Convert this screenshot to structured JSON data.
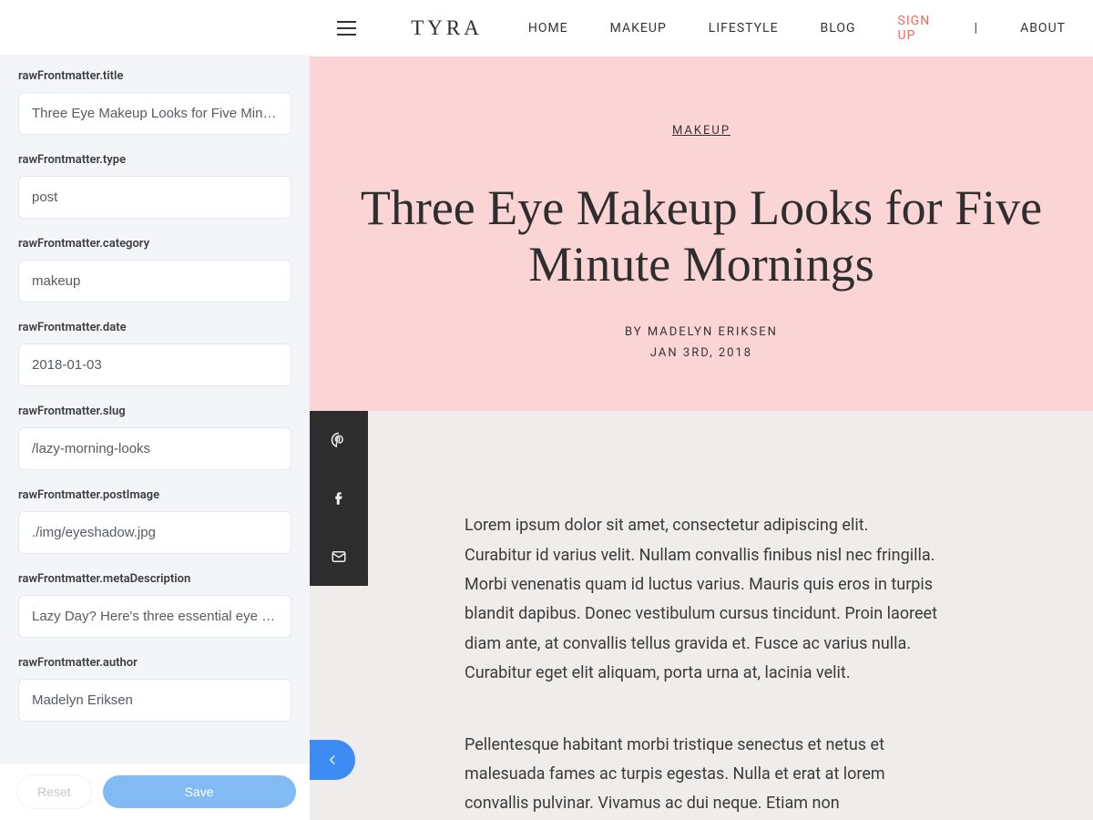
{
  "editor": {
    "fields": [
      {
        "label": "rawFrontmatter.title",
        "value": "Three Eye Makeup Looks for Five Minute Mornings"
      },
      {
        "label": "rawFrontmatter.type",
        "value": "post"
      },
      {
        "label": "rawFrontmatter.category",
        "value": "makeup"
      },
      {
        "label": "rawFrontmatter.date",
        "value": "2018-01-03"
      },
      {
        "label": "rawFrontmatter.slug",
        "value": "/lazy-morning-looks"
      },
      {
        "label": "rawFrontmatter.postImage",
        "value": "./img/eyeshadow.jpg"
      },
      {
        "label": "rawFrontmatter.metaDescription",
        "value": "Lazy Day? Here's three essential eye makeup looks for five minute mornings."
      },
      {
        "label": "rawFrontmatter.author",
        "value": "Madelyn Eriksen"
      }
    ],
    "reset_label": "Reset",
    "save_label": "Save"
  },
  "site": {
    "brand": "TYRA",
    "nav": [
      {
        "label": "HOME",
        "accent": false
      },
      {
        "label": "MAKEUP",
        "accent": false
      },
      {
        "label": "LIFESTYLE",
        "accent": false
      },
      {
        "label": "BLOG",
        "accent": false
      },
      {
        "label": "SIGN UP",
        "accent": true
      },
      {
        "label": "|",
        "accent": false,
        "sep": true
      },
      {
        "label": "ABOUT",
        "accent": false
      }
    ]
  },
  "post": {
    "category": "MAKEUP",
    "title": "Three Eye Makeup Looks for Five Minute Mornings",
    "byline": "BY MADELYN ERIKSEN",
    "date": "JAN 3RD, 2018",
    "paragraphs": [
      "Lorem ipsum dolor sit amet, consectetur adipiscing elit. Curabitur id varius velit. Nullam convallis finibus nisl nec fringilla. Morbi venenatis quam id luctus varius. Mauris quis eros in turpis blandit dapibus. Donec vestibulum cursus tincidunt. Proin laoreet diam ante, at convallis tellus gravida et. Fusce ac varius nulla. Curabitur eget elit aliquam, porta urna at, lacinia velit.",
      "Pellentesque habitant morbi tristique senectus et netus et malesuada fames ac turpis egestas. Nulla et erat at lorem convallis pulvinar. Vivamus ac dui neque. Etiam non"
    ]
  }
}
